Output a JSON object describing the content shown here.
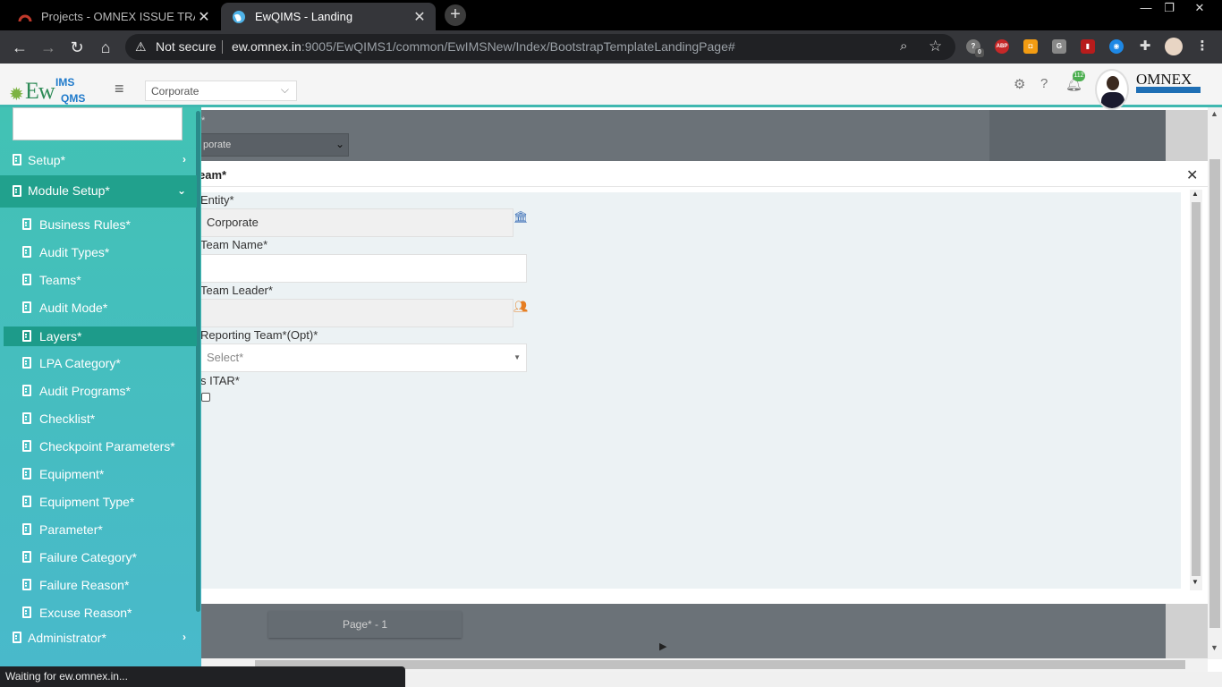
{
  "browser": {
    "tabs": [
      {
        "title": "Projects - OMNEX ISSUE TRACKE",
        "active": false
      },
      {
        "title": "EwQIMS - Landing",
        "active": true
      }
    ],
    "new_tab": "+",
    "address": {
      "security": "Not secure",
      "host": "ew.omnex.in",
      "path": ":9005/EwQIMS1/common/EwIMSNew/Index/BootstrapTemplateLandingPage#"
    },
    "extension_badge": "0",
    "extension_abp": "ABP",
    "extension_g": "G"
  },
  "header": {
    "logo_main": "Ew",
    "logo_top": "IMS",
    "logo_bottom": "QMS",
    "entity_selected": "Corporate",
    "notification_count": "112",
    "company_logo": "OMNEX"
  },
  "background": {
    "select_text": "porate",
    "pager": "Page* - 1"
  },
  "modal": {
    "title": "eam*",
    "entity_label": "Entity*",
    "entity_value": "Corporate",
    "team_name_label": "Team Name*",
    "team_name_value": "",
    "team_leader_label": "Team Leader*",
    "team_leader_value": "",
    "reporting_team_label": "Reporting Team*(Opt)*",
    "reporting_team_placeholder": "Select*",
    "itar_label": "s ITAR*",
    "itar_checked": false
  },
  "sidebar": {
    "setup": "Setup*",
    "module_setup": "Module Setup*",
    "items": [
      "Business Rules*",
      "Audit Types*",
      "Teams*",
      "Audit Mode*",
      "Layers*",
      "LPA Category*",
      "Audit Programs*",
      "Checklist*",
      "Checkpoint Parameters*",
      "Equipment*",
      "Equipment Type*",
      "Parameter*",
      "Failure Category*",
      "Failure Reason*",
      "Excuse Reason*"
    ],
    "active_item": "Layers*",
    "administrator": "Administrator*"
  },
  "status": "Waiting for ew.omnex.in...",
  "colors": {
    "sidebar_top": "#42c2b4",
    "sidebar_active": "#1d9b8a",
    "accent": "#3fb8b0"
  }
}
